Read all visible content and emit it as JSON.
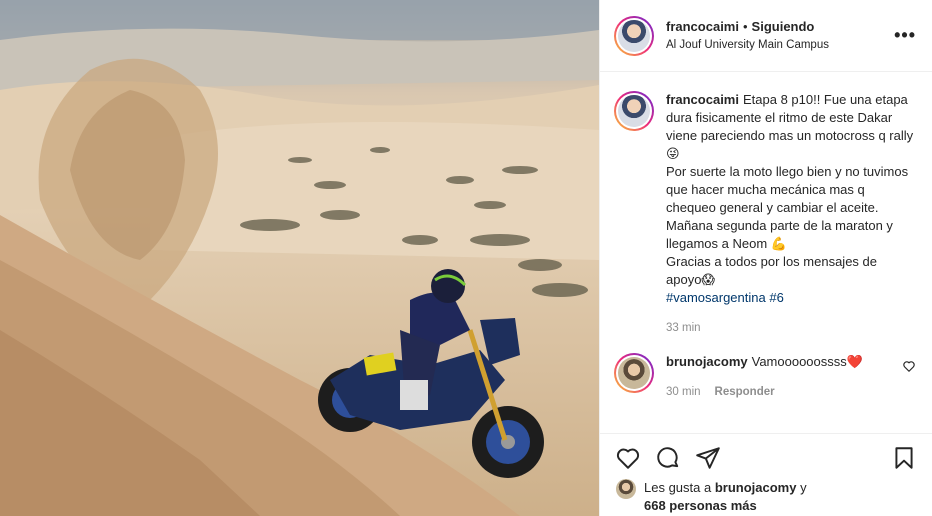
{
  "post": {
    "author": {
      "username": "francocaimi",
      "separator": "•",
      "follow_status": "Siguiendo",
      "location": "Al Jouf University Main Campus"
    },
    "more_label": "•••",
    "caption": {
      "username": "francocaimi",
      "lines": [
        "Etapa 8 p10!! Fue una etapa dura fisicamente el ritmo de este Dakar viene pareciendo mas un motocross q rally 😜",
        "Por suerte la moto llego bien y no tuvimos que hacer mucha mecánica mas q chequeo general y cambiar el aceite. Mañana segunda parte de la maraton y llegamos a Neom 💪",
        "Gracias a todos por los mensajes de apoyo😱"
      ],
      "hashtags": "#vamosargentina #6",
      "time": "33 min"
    },
    "comments": [
      {
        "username": "brunojacomy",
        "text": "Vamoooooossss❤️",
        "time": "30 min",
        "reply_label": "Responder"
      }
    ],
    "likes": {
      "prefix": "Les gusta a",
      "liker": "brunojacomy",
      "conjunction": "y",
      "count_text": "668 personas más"
    },
    "icons": {
      "like": "heart-icon",
      "comment": "comment-icon",
      "share": "paper-plane-icon",
      "save": "bookmark-icon",
      "comment_like": "heart-small-icon",
      "options": "more-options-icon"
    }
  }
}
